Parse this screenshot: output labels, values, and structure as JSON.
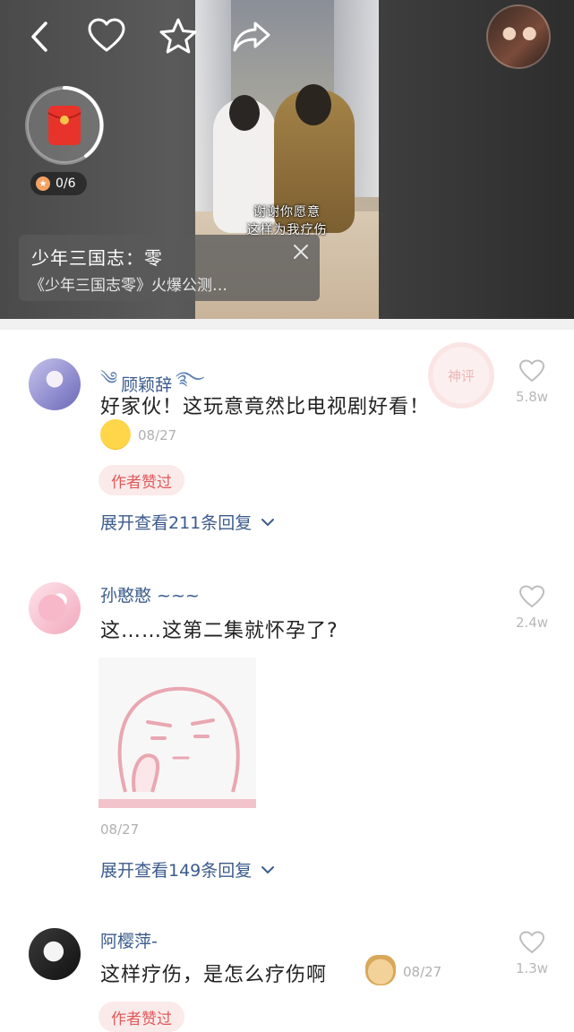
{
  "video": {
    "subtitle_line1": "谢谢你愿意",
    "subtitle_line2": "这样为我疗伤",
    "red_packet_progress": "0/6",
    "info_title": "少年三国志：零",
    "info_subtitle": "《少年三国志零》火爆公测…"
  },
  "toolbar": {
    "back_icon": "back-arrow-icon",
    "like_icon": "heart-icon",
    "favorite_icon": "star-icon",
    "share_icon": "share-icon"
  },
  "watermark": "神评",
  "comments": [
    {
      "user": "顾颖辞",
      "text": "好家伙！这玩意竟然比电视剧好看！",
      "date": "08/27",
      "badge": "作者赞过",
      "expand": "展开查看211条回复",
      "likes": "5.8w"
    },
    {
      "user": "孙憨憨 ~~~",
      "text": "这……这第二集就怀孕了?",
      "date": "08/27",
      "expand": "展开查看149条回复",
      "likes": "2.4w"
    },
    {
      "user": "阿樱萍-",
      "text": "这样疗伤，是怎么疗伤啊",
      "date": "08/27",
      "badge": "作者赞过",
      "likes": "1.3w"
    }
  ],
  "colors": {
    "username": "#3b5b8c",
    "badge_bg": "#fbeaea",
    "badge_text": "#e0595a",
    "red_packet": "#e8332b"
  }
}
